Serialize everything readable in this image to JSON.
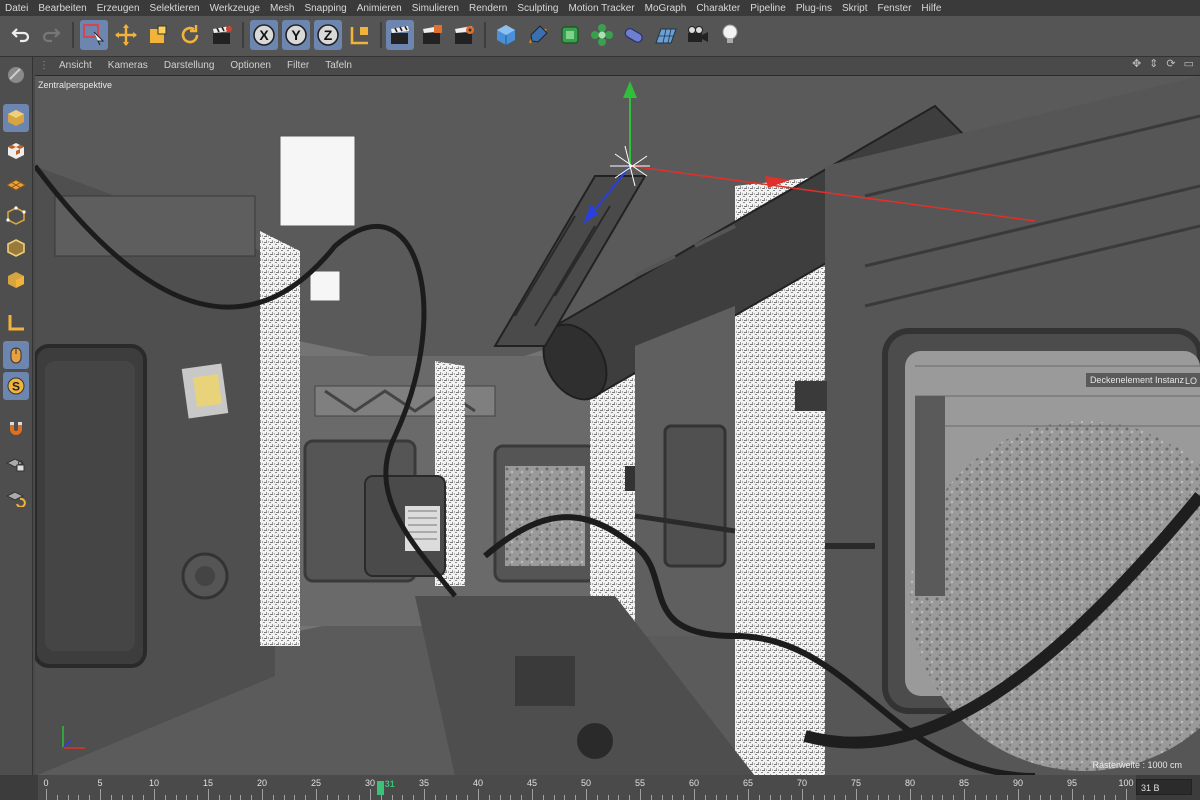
{
  "menu": [
    "Datei",
    "Bearbeiten",
    "Erzeugen",
    "Selektieren",
    "Werkzeuge",
    "Mesh",
    "Snapping",
    "Animieren",
    "Simulieren",
    "Rendern",
    "Sculpting",
    "Motion Tracker",
    "MoGraph",
    "Charakter",
    "Pipeline",
    "Plug-ins",
    "Skript",
    "Fenster",
    "Hilfe"
  ],
  "viewport_menu": [
    "Ansicht",
    "Kameras",
    "Darstellung",
    "Optionen",
    "Filter",
    "Tafeln"
  ],
  "viewport": {
    "camera_label": "Zentralperspektive",
    "tooltip": "Deckenelement Instanz",
    "tooltip_icon": "LO",
    "grid_label": "Rasterweite : 1000 cm"
  },
  "toolbar": {
    "axis_x": "X",
    "axis_y": "Y",
    "axis_z": "Z"
  },
  "timeline": {
    "ticks": [
      "0",
      "5",
      "10",
      "15",
      "20",
      "25",
      "30",
      "35",
      "40",
      "45",
      "50",
      "55",
      "60",
      "65",
      "70",
      "75",
      "80",
      "85",
      "90",
      "95",
      "100"
    ],
    "current_frame": "31",
    "current_frame_value": 31,
    "end_field": "31 B"
  },
  "colors": {
    "selection": "#6d86b0",
    "playhead": "#3cc07a",
    "axis_x": "#e0302a",
    "axis_y": "#2fbf3a",
    "axis_z": "#2a3fe0"
  }
}
